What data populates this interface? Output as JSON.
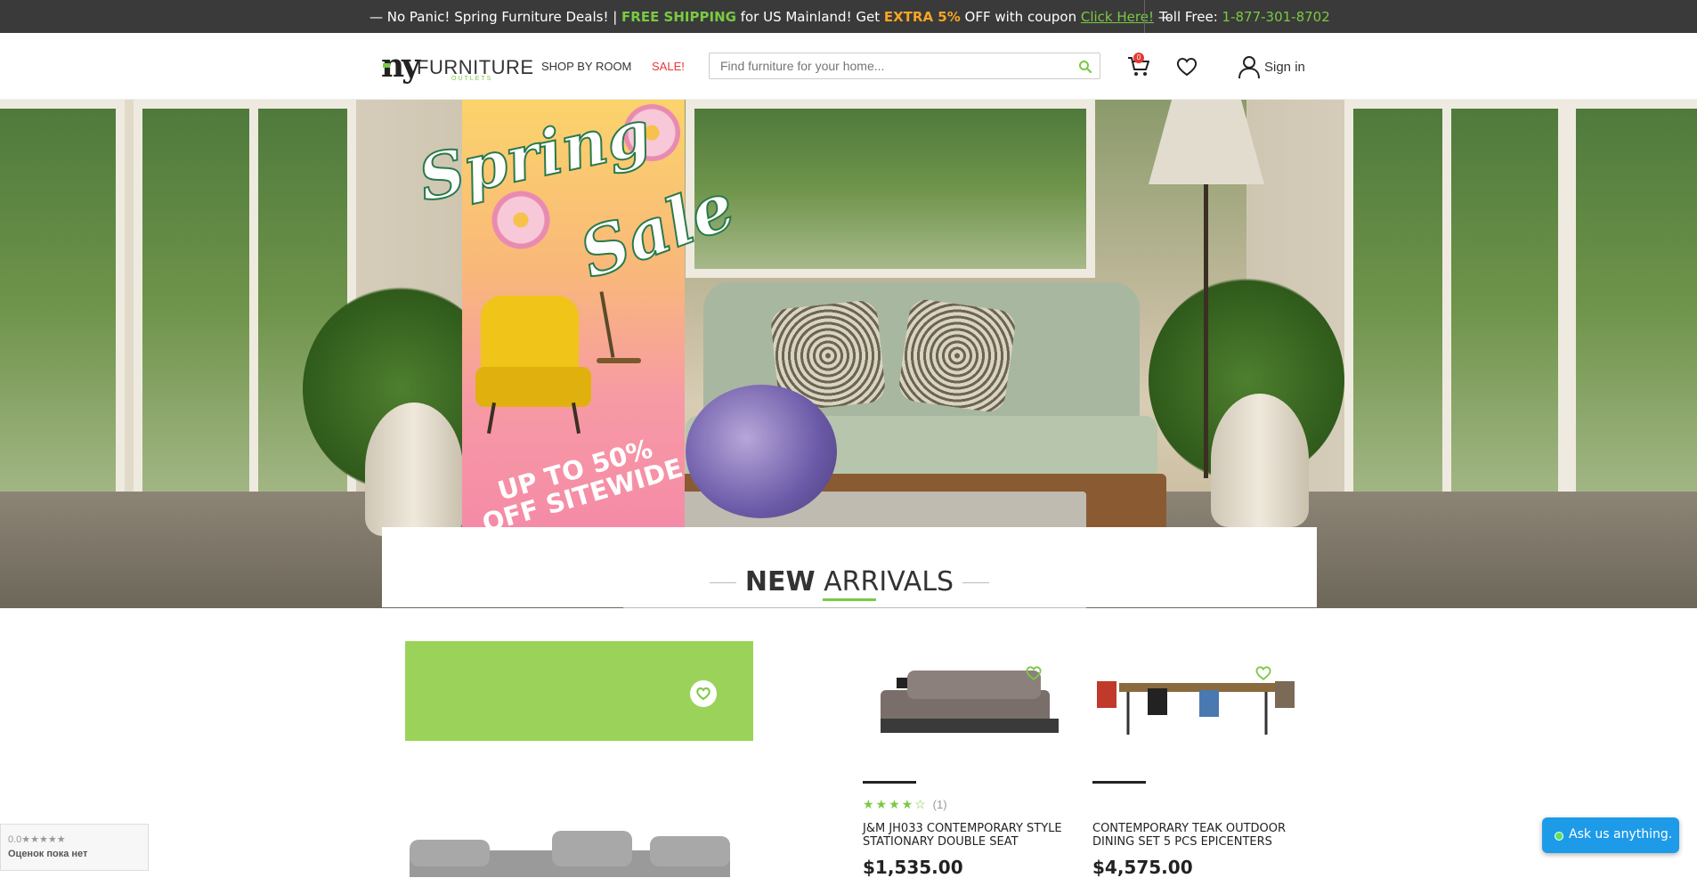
{
  "topbar": {
    "promo_prefix": "— No Panic! Spring Furniture Deals! | ",
    "free_shipping": "FREE SHIPPING",
    "promo_mid": " for US Mainland! Get ",
    "extra": "EXTRA 5%",
    "promo_off": " OFF with coupon ",
    "click_here": "Click Here!",
    "promo_suffix": " —",
    "toll_label": "Toll Free: ",
    "toll_number": "1-877-301-8702"
  },
  "header": {
    "logo_ny": "ny",
    "logo_furniture": "FURNITURE",
    "logo_outlets": "OUTLETS",
    "nav_shop_by_room": "SHOP BY ROOM",
    "nav_sale": "SALE!",
    "search_placeholder": "Find furniture for your home...",
    "cart_count": "0",
    "sign_in": "Sign in",
    "icons": [
      "search-icon",
      "cart-icon",
      "heart-icon",
      "user-icon"
    ]
  },
  "hero": {
    "headline_1": "Spring",
    "headline_2": "Sale",
    "offer": "UP TO 50% OFF SITEWIDE"
  },
  "section": {
    "title_bold": "NEW",
    "title_light": "ARRIVALS"
  },
  "products": [
    {
      "name": "J&M JH033 CONTEMPORARY STYLE STATIONARY DOUBLE SEAT",
      "stars": "★★★★☆",
      "review_count": "(1)",
      "price": "$1,535.00"
    },
    {
      "name": "CONTEMPORARY TEAK OUTDOOR DINING SET 5 PCS EPICENTERS",
      "stars": "",
      "review_count": "",
      "price": "$4,575.00"
    }
  ],
  "widgets": {
    "reviews_score": "0.0★★★★★",
    "reviews_label": "Оценок пока нет",
    "chat_label": "Ask us anything."
  },
  "colors": {
    "accent_green": "#7ac943",
    "topbar_bg": "#3a3a3a",
    "sale_red": "#e53935",
    "coupon_orange": "#f5a623",
    "chat_blue": "#1e9be8"
  }
}
